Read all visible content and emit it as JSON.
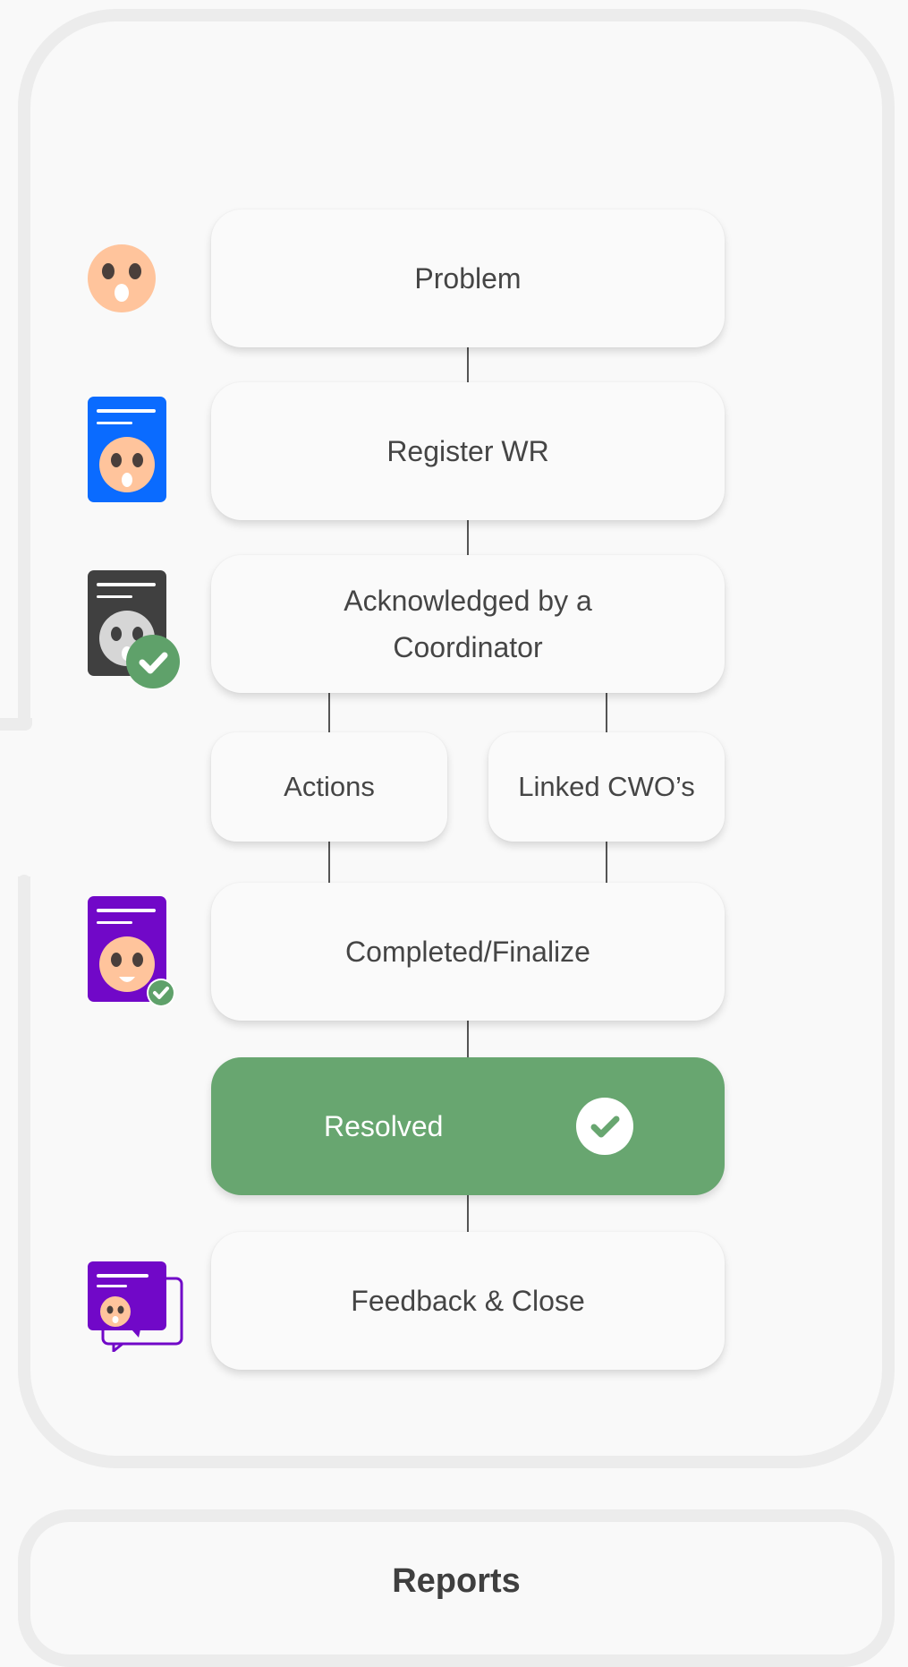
{
  "flow": {
    "problem": "Problem",
    "register": "Register WR",
    "acknowledged": "Acknowledged by a Coordinator",
    "actions": "Actions",
    "linked": "Linked CWO’s",
    "completed": "Completed/Finalize",
    "resolved": "Resolved",
    "feedback": "Feedback & Close"
  },
  "reports": {
    "label": "Reports"
  },
  "colors": {
    "resolved_green": "#68a670",
    "face_skin": "#ffc49c",
    "register_blue": "#0a6bff",
    "ack_dark": "#404040",
    "completed_purple": "#7108c8",
    "check_green": "#5fa16a",
    "frame_grey": "#ececec"
  },
  "icons": {
    "problem": "surprised-face-icon",
    "register": "blue-document-face-icon",
    "acknowledged": "dark-document-check-icon",
    "completed": "purple-document-smile-icon",
    "resolved": "check-circle-icon",
    "feedback": "chat-document-face-icon"
  }
}
